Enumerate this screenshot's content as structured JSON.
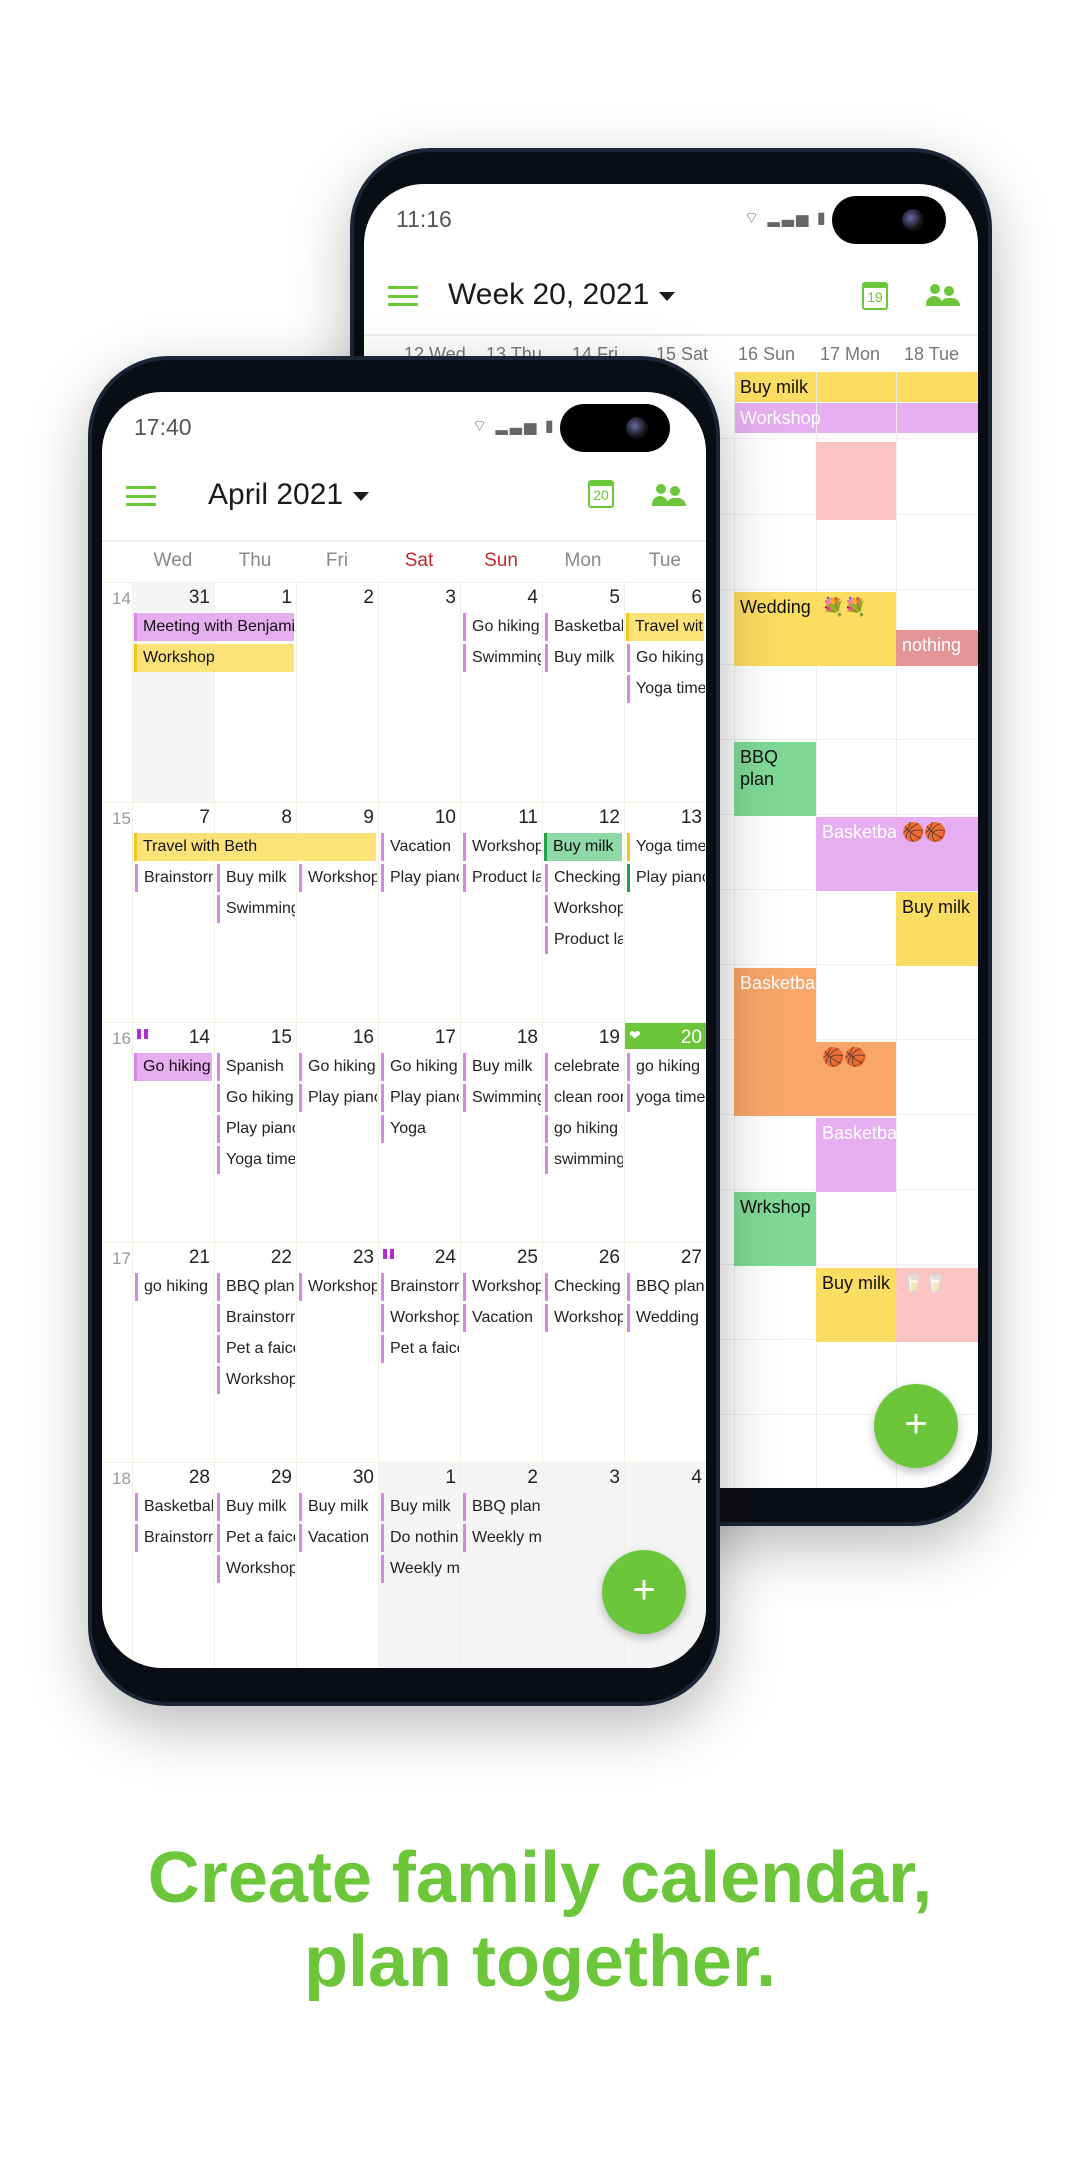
{
  "back_phone": {
    "status_time": "11:16",
    "status_icons": "wifi-icon signal-icon battery-icon",
    "title": "Week 20, 2021",
    "today_badge": "19",
    "day_headers": [
      "12 Wed",
      "13 Thu",
      "14 Fri",
      "15 Sat",
      "16 Sun",
      "17 Mon",
      "18 Tue"
    ],
    "allday_events": [
      {
        "title": "Buy milk",
        "color": "#fddc62"
      },
      {
        "title": "Workshop",
        "color": "#e6aef0"
      }
    ],
    "events": [
      {
        "title": "",
        "day": "17 Mon",
        "color": "#fdc4c4"
      },
      {
        "title": "Wedding",
        "day": "16 Sun",
        "color": "#fddc62"
      },
      {
        "title": "💐💐",
        "day": "17 Mon",
        "color": "#fddc62"
      },
      {
        "title": "nothing",
        "day": "18 Tue",
        "color": "#e39595"
      },
      {
        "title": "BBQ plan",
        "day": "16 Sun",
        "color": "#7fd996"
      },
      {
        "title": "Basketball",
        "day": "17 Mon",
        "color": "#e6aef0"
      },
      {
        "title": "🏀🏀",
        "day": "18 Tue",
        "color": "#e6aef0"
      },
      {
        "title": "Buy milk",
        "day": "18 Tue",
        "color": "#fddc62"
      },
      {
        "title": "Basketball",
        "day": "16 Sun",
        "color": "#f8a66a"
      },
      {
        "title": "🏀🏀",
        "day": "17 Mon",
        "color": "#f8a66a"
      },
      {
        "title": "Basketball",
        "day": "17 Mon",
        "color": "#e6aef0"
      },
      {
        "title": "Wrkshop",
        "day": "16 Sun",
        "color": "#7fd996"
      },
      {
        "title": "Buy milk",
        "day": "17 Mon",
        "color": "#fddc62"
      },
      {
        "title": "🥛🥛",
        "day": "18 Tue",
        "color": "#fdc4c4"
      }
    ],
    "fab_label": "+"
  },
  "front_phone": {
    "status_time": "17:40",
    "status_icons": "wifi-icon signal-icon battery-icon",
    "title": "April 2021",
    "today_badge": "20",
    "weekday_headers": [
      "Wed",
      "Thu",
      "Fri",
      "Sat",
      "Sun",
      "Mon",
      "Tue"
    ],
    "weeks": [
      {
        "num": "14",
        "days": [
          {
            "d": "31",
            "events": []
          },
          {
            "d": "1",
            "events": []
          },
          {
            "d": "2",
            "events": []
          },
          {
            "d": "3",
            "events": []
          },
          {
            "d": "4",
            "events": [
              "Go hiking",
              "Swimming"
            ]
          },
          {
            "d": "5",
            "events": [
              "Basketball",
              "Buy milk"
            ]
          },
          {
            "d": "6",
            "events": [
              "Go hiking",
              "Yoga time"
            ]
          }
        ],
        "spans": [
          {
            "title": "Meeting with Benjamin",
            "color": "#e6aef0",
            "bar": "#d687e0"
          },
          {
            "title": "Workshop",
            "color": "#fde27a",
            "bar": "#f5c518"
          },
          {
            "title": "Travel with Beth",
            "color": "#fde27a",
            "bar": "#f5c518"
          }
        ]
      },
      {
        "num": "15",
        "days": [
          {
            "d": "7",
            "events": [
              "Brainstorming"
            ]
          },
          {
            "d": "8",
            "events": [
              "Buy milk",
              "Swimming"
            ]
          },
          {
            "d": "9",
            "events": [
              "Workshop"
            ]
          },
          {
            "d": "10",
            "events": [
              "Vacation",
              "Play piano"
            ]
          },
          {
            "d": "11",
            "events": [
              "Workshop",
              "Product launch"
            ]
          },
          {
            "d": "12",
            "events": [
              "Checking",
              "Workshop",
              "Product launch"
            ]
          },
          {
            "d": "13",
            "events": [
              "Yoga time",
              "Play piano"
            ]
          }
        ],
        "spans": [
          {
            "title": "Travel with Beth",
            "color": "#fde27a",
            "bar": "#f5c518"
          },
          {
            "title": "Buy milk",
            "color": "#8fd9a8",
            "bar": "#22a04a"
          }
        ]
      },
      {
        "num": "16",
        "days": [
          {
            "d": "14",
            "events": []
          },
          {
            "d": "15",
            "events": [
              "Spanish",
              "Go hiking",
              "Play piano",
              "Yoga time"
            ]
          },
          {
            "d": "16",
            "events": [
              "Go hiking",
              "Play piano"
            ]
          },
          {
            "d": "17",
            "events": [
              "Go hiking",
              "Play piano",
              "Yoga"
            ]
          },
          {
            "d": "18",
            "events": [
              "Buy milk",
              "Swimming"
            ]
          },
          {
            "d": "19",
            "events": [
              "celebrate",
              "clean room",
              "go hiking",
              "swimming"
            ]
          },
          {
            "d": "20",
            "events": [
              "go hiking",
              "yoga time"
            ]
          }
        ],
        "spans": [
          {
            "title": "Go hiking",
            "color": "#e6aef0",
            "bar": "#d687e0"
          }
        ]
      },
      {
        "num": "17",
        "days": [
          {
            "d": "21",
            "events": [
              "go hiking"
            ]
          },
          {
            "d": "22",
            "events": [
              "BBQ plan",
              "Brainstorming",
              "Pet a faicon",
              "Workshop"
            ]
          },
          {
            "d": "23",
            "events": [
              "Workshop"
            ]
          },
          {
            "d": "24",
            "events": [
              "Brainstorming",
              "Workshop",
              "Pet a faicon"
            ]
          },
          {
            "d": "25",
            "events": [
              "Workshop",
              "Vacation"
            ]
          },
          {
            "d": "26",
            "events": [
              "Checking",
              "Workshop"
            ]
          },
          {
            "d": "27",
            "events": [
              "BBQ plan",
              "Wedding"
            ]
          }
        ]
      },
      {
        "num": "18",
        "days": [
          {
            "d": "28",
            "events": [
              "Basketball",
              "Brainstorming"
            ]
          },
          {
            "d": "29",
            "events": [
              "Buy milk",
              "Pet a faicon",
              "Workshop"
            ]
          },
          {
            "d": "30",
            "events": [
              "Buy milk",
              "Vacation"
            ]
          },
          {
            "d": "1",
            "events": [
              "Buy milk",
              "Do nothing",
              "Weekly meeting"
            ]
          },
          {
            "d": "2",
            "events": [
              "BBQ plan",
              "Weekly meeting"
            ]
          },
          {
            "d": "3",
            "events": []
          },
          {
            "d": "4",
            "events": []
          }
        ]
      }
    ],
    "fab_label": "+"
  },
  "caption": {
    "line1": "Create family calendar,",
    "line2": "plan together."
  },
  "colors": {
    "accent": "#6cc63a",
    "weekend": "#c0282e"
  }
}
